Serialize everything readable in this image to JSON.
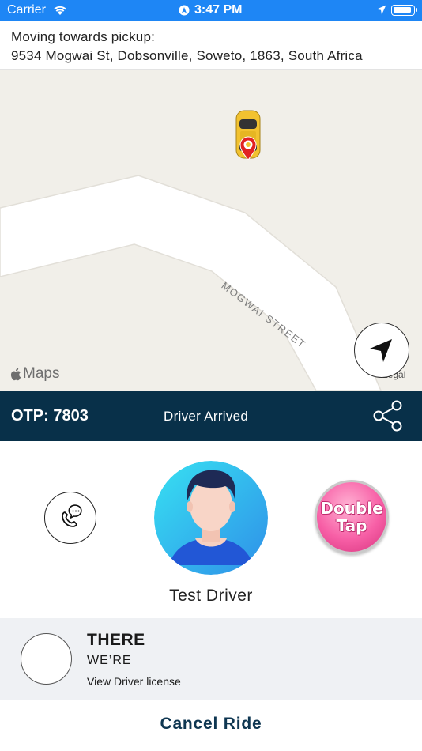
{
  "status_bar": {
    "carrier": "Carrier",
    "time": "3:47 PM",
    "battery_level": 0.95
  },
  "pickup": {
    "label": "Moving towards pickup:",
    "address": "9534 Mogwai St, Dobsonville, Soweto, 1863, South Africa"
  },
  "map": {
    "street_name": "MOGWAI STREET",
    "provider": "Maps",
    "legal": "Legal",
    "recenter_icon": "navigation-arrow-icon",
    "car_icon": "taxi-car-icon"
  },
  "ride_status": {
    "otp": "OTP: 7803",
    "state": "Driver Arrived",
    "share_icon": "share-icon"
  },
  "driver": {
    "name": "Test Driver",
    "call_icon": "phone-chat-icon",
    "double_tap_line1": "Double",
    "double_tap_line2": "Tap"
  },
  "vehicle": {
    "model": "THERE",
    "plate": "WE’RE",
    "license_link": "View Driver license"
  },
  "actions": {
    "cancel": "Cancel Ride"
  },
  "colors": {
    "status_bar": "#1e86f5",
    "otp_bar": "#083049",
    "map_bg": "#f1efe9",
    "cancel_text": "#0e3651"
  }
}
